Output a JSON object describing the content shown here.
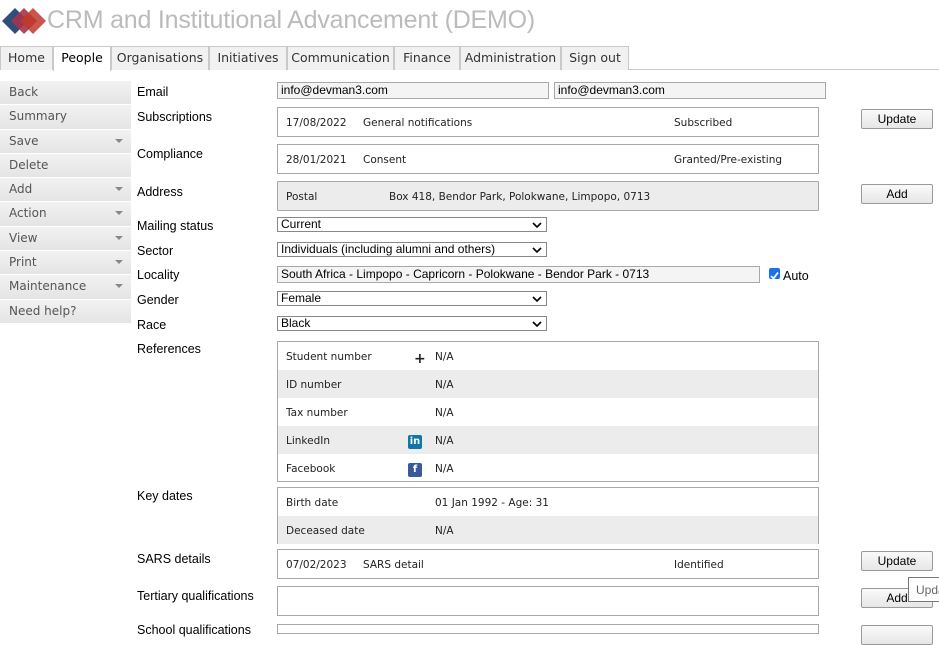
{
  "app": {
    "title": "CRM and Institutional Advancement (DEMO)"
  },
  "nav": {
    "tabs": [
      "Home",
      "People",
      "Organisations",
      "Initiatives",
      "Communication",
      "Finance",
      "Administration",
      "Sign out"
    ]
  },
  "sidebar": {
    "items": [
      {
        "label": "Back"
      },
      {
        "label": "Summary"
      },
      {
        "label": "Save"
      },
      {
        "label": "Delete"
      },
      {
        "label": "Add"
      },
      {
        "label": "Action"
      },
      {
        "label": "View"
      },
      {
        "label": "Print"
      },
      {
        "label": "Maintenance"
      },
      {
        "label": "Need help?"
      }
    ]
  },
  "labels": {
    "email": "Email",
    "subscriptions": "Subscriptions",
    "compliance": "Compliance",
    "address": "Address",
    "mailing_status": "Mailing status",
    "sector": "Sector",
    "locality": "Locality",
    "gender": "Gender",
    "race": "Race",
    "references": "References",
    "key_dates": "Key dates",
    "sars_details": "SARS details",
    "tertiary": "Tertiary qualifications",
    "school": "School qualifications"
  },
  "email": {
    "primary": "info@devman3.com",
    "secondary": "info@devman3.com"
  },
  "subscriptions": {
    "date": "17/08/2022",
    "type": "General notifications",
    "status": "Subscribed"
  },
  "compliance": {
    "date": "28/01/2021",
    "type": "Consent",
    "status": "Granted/Pre-existing"
  },
  "address": {
    "type": "Postal",
    "value": "Box 418, Bendor Park, Polokwane, Limpopo, 0713"
  },
  "mailing_status": "Current",
  "sector": "Individuals (including alumni and others)",
  "locality": {
    "value": "South Africa - Limpopo - Capricorn - Polokwane - Bendor Park - 0713",
    "auto_label": "Auto",
    "auto_checked": true
  },
  "gender": "Female",
  "race": "Black",
  "references": [
    {
      "label": "Student number",
      "value": "N/A",
      "icon": "plus-icon"
    },
    {
      "label": "ID number",
      "value": "N/A"
    },
    {
      "label": "Tax number",
      "value": "N/A"
    },
    {
      "label": "LinkedIn",
      "value": "N/A",
      "icon": "linkedin-icon"
    },
    {
      "label": "Facebook",
      "value": "N/A",
      "icon": "facebook-icon"
    }
  ],
  "key_dates": [
    {
      "label": "Birth date",
      "value": "01 Jan 1992 - Age: 31"
    },
    {
      "label": "Deceased date",
      "value": "N/A"
    }
  ],
  "sars": {
    "date": "07/02/2023",
    "type": "SARS detail",
    "status": "Identified"
  },
  "buttons": {
    "update": "Update",
    "add": "Add"
  },
  "tooltip": "Update",
  "colors": {
    "logo_dark": "#2c4f7c",
    "logo_red": "#c0392b",
    "title_grey": "#bbbbbb",
    "checkbox": "#1a73e8"
  }
}
